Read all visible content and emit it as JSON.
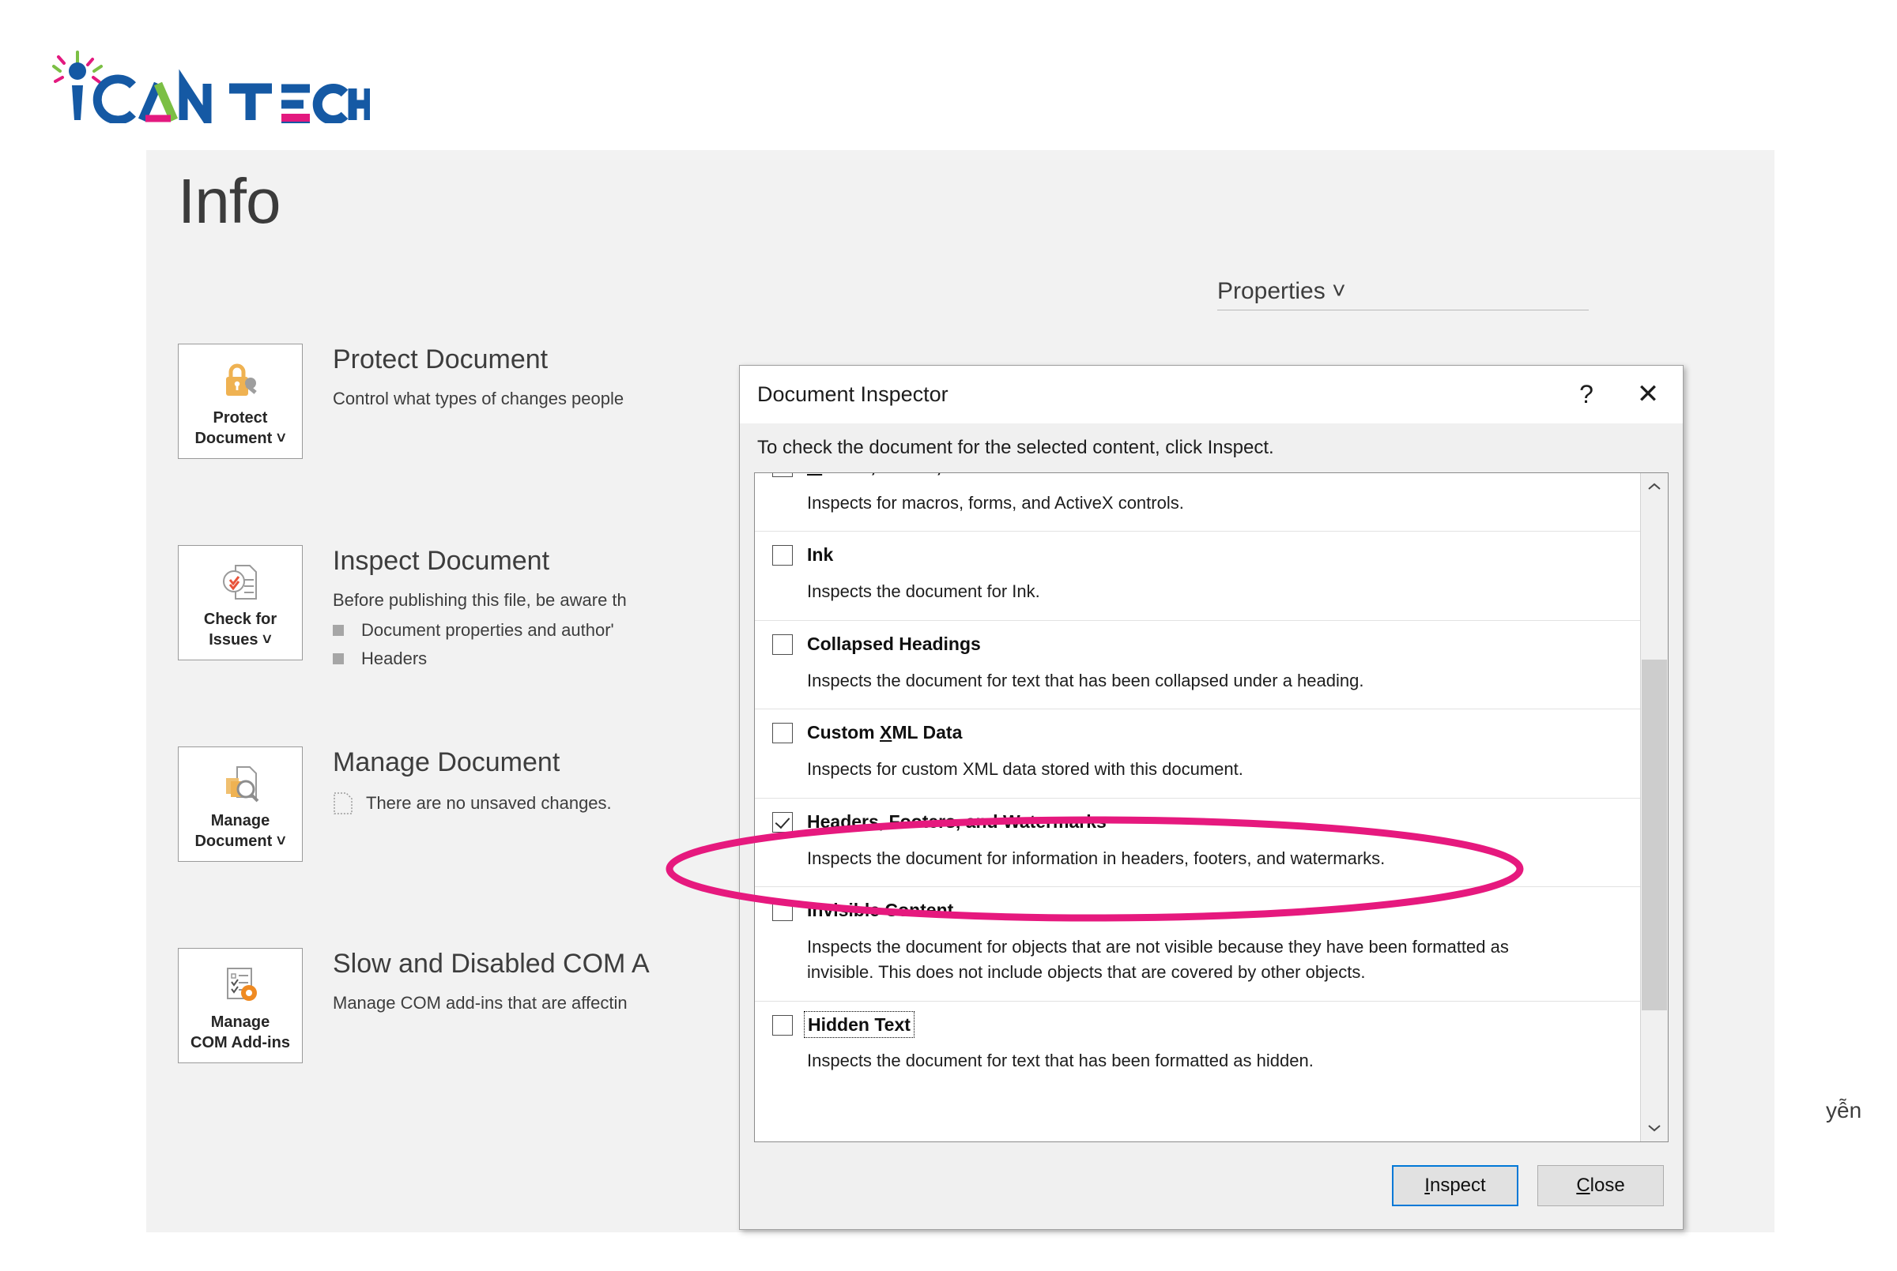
{
  "brand": {
    "name": "iCAN TECH",
    "word_i": "i",
    "word_can": "CAN",
    "word_tech": "TECH",
    "colors": {
      "blue": "#1559a4",
      "pink": "#e3197f",
      "green": "#7bbf44"
    }
  },
  "backstage": {
    "title": "Info",
    "properties_label": "Properties ˅",
    "author_fragment": "yễn",
    "cards": [
      {
        "tile_label_line1": "Protect",
        "tile_label_line2": "Document ˅",
        "icon": "lock-key-icon",
        "heading": "Protect Document",
        "description": "Control what types of changes people",
        "bullets": [],
        "inline": null
      },
      {
        "tile_label_line1": "Check for",
        "tile_label_line2": "Issues ˅",
        "icon": "document-check-icon",
        "heading": "Inspect Document",
        "description": "Before publishing this file, be aware th",
        "bullets": [
          "Document properties and author'",
          "Headers"
        ],
        "inline": null
      },
      {
        "tile_label_line1": "Manage",
        "tile_label_line2": "Document ˅",
        "icon": "document-stack-search-icon",
        "heading": "Manage Document",
        "description": null,
        "bullets": [],
        "inline": "There are no unsaved changes."
      },
      {
        "tile_label_line1": "Manage",
        "tile_label_line2": "COM Add-ins",
        "icon": "checklist-gear-icon",
        "heading": "Slow and Disabled COM A",
        "description": "Manage COM add-ins that are affectin",
        "bullets": [],
        "inline": null
      }
    ]
  },
  "dialog": {
    "title": "Document Inspector",
    "help_glyph": "?",
    "close_glyph": "✕",
    "instruction": "To check the document for the selected content, click Inspect.",
    "items": [
      {
        "title": "Macros, Forms, and ActiveX Controls",
        "accel": "M",
        "description": "Inspects for macros, forms, and ActiveX controls.",
        "checked": false,
        "focused": false,
        "clipped": true
      },
      {
        "title": "Ink",
        "accel": null,
        "description": "Inspects the document for Ink.",
        "checked": false,
        "focused": false,
        "clipped": false
      },
      {
        "title": "Collapsed Headings",
        "accel": null,
        "description": "Inspects the document for text that has been collapsed under a heading.",
        "checked": false,
        "focused": false,
        "clipped": false
      },
      {
        "title": "Custom XML Data",
        "accel": "X",
        "description": "Inspects for custom XML data stored with this document.",
        "checked": false,
        "focused": false,
        "clipped": false
      },
      {
        "title": "Headers, Footers, and Watermarks",
        "accel": null,
        "description": "Inspects the document for information in headers, footers, and watermarks.",
        "checked": true,
        "focused": false,
        "clipped": false
      },
      {
        "title": "Invisible Content",
        "accel": null,
        "description": "Inspects the document for objects that are not visible because they have been formatted as invisible. This does not include objects that are covered by other objects.",
        "checked": false,
        "focused": false,
        "clipped": false
      },
      {
        "title": "Hidden Text",
        "accel": null,
        "description": "Inspects the document for text that has been formatted as hidden.",
        "checked": false,
        "focused": true,
        "clipped": false
      }
    ],
    "scrollbar": {
      "up_glyph": "⌃",
      "down_glyph": "⌄",
      "thumb_top_pct": 26,
      "thumb_height_pct": 57
    },
    "buttons": [
      {
        "label": "Inspect",
        "accel": "I",
        "default": true
      },
      {
        "label": "Close",
        "accel": "C",
        "default": false
      }
    ]
  },
  "annotation": {
    "shape": "ellipse",
    "color": "#e6197e",
    "stroke_width": 9,
    "targets": "Headers, Footers, and Watermarks"
  }
}
